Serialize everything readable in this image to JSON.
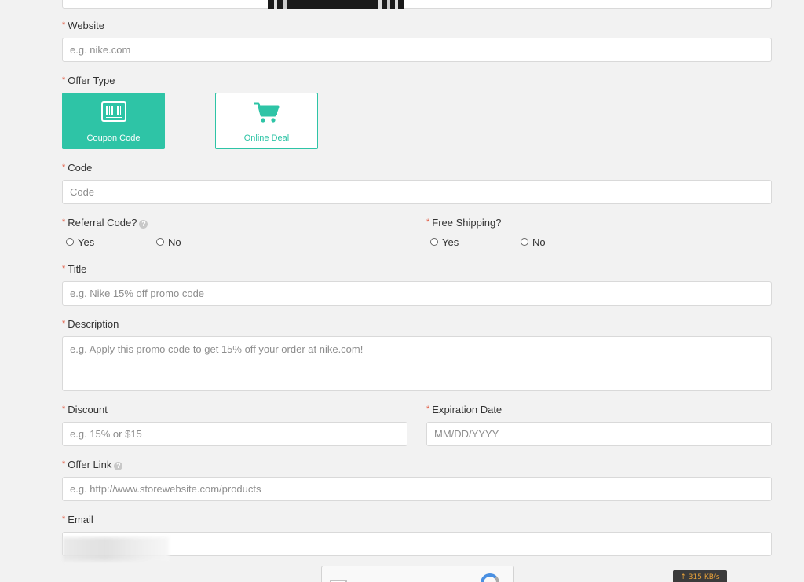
{
  "form": {
    "website": {
      "label": "Website",
      "placeholder": "e.g. nike.com"
    },
    "offer_type": {
      "label": "Offer Type",
      "options": [
        {
          "label": "Coupon Code",
          "icon": "barcode-icon",
          "selected": true
        },
        {
          "label": "Online Deal",
          "icon": "cart-icon",
          "selected": false
        }
      ]
    },
    "code": {
      "label": "Code",
      "placeholder": "Code"
    },
    "referral": {
      "label": "Referral Code?",
      "yes": "Yes",
      "no": "No"
    },
    "free_shipping": {
      "label": "Free Shipping?",
      "yes": "Yes",
      "no": "No"
    },
    "title": {
      "label": "Title",
      "placeholder": "e.g. Nike 15% off promo code"
    },
    "description": {
      "label": "Description",
      "placeholder": "e.g. Apply this promo code to get 15% off your order at nike.com!"
    },
    "discount": {
      "label": "Discount",
      "placeholder": "e.g. 15% or $15"
    },
    "expiration": {
      "label": "Expiration Date",
      "placeholder": "MM/DD/YYYY"
    },
    "offer_link": {
      "label": "Offer Link",
      "placeholder": "e.g. http://www.storewebsite.com/products"
    },
    "email": {
      "label": "Email",
      "value": ""
    },
    "required_marker": "*",
    "help_marker": "?"
  },
  "status": {
    "speed": "↑ 315 KB/s"
  },
  "colors": {
    "accent": "#2ec4a6",
    "required": "#e0533a",
    "background": "#f2f2f2"
  }
}
